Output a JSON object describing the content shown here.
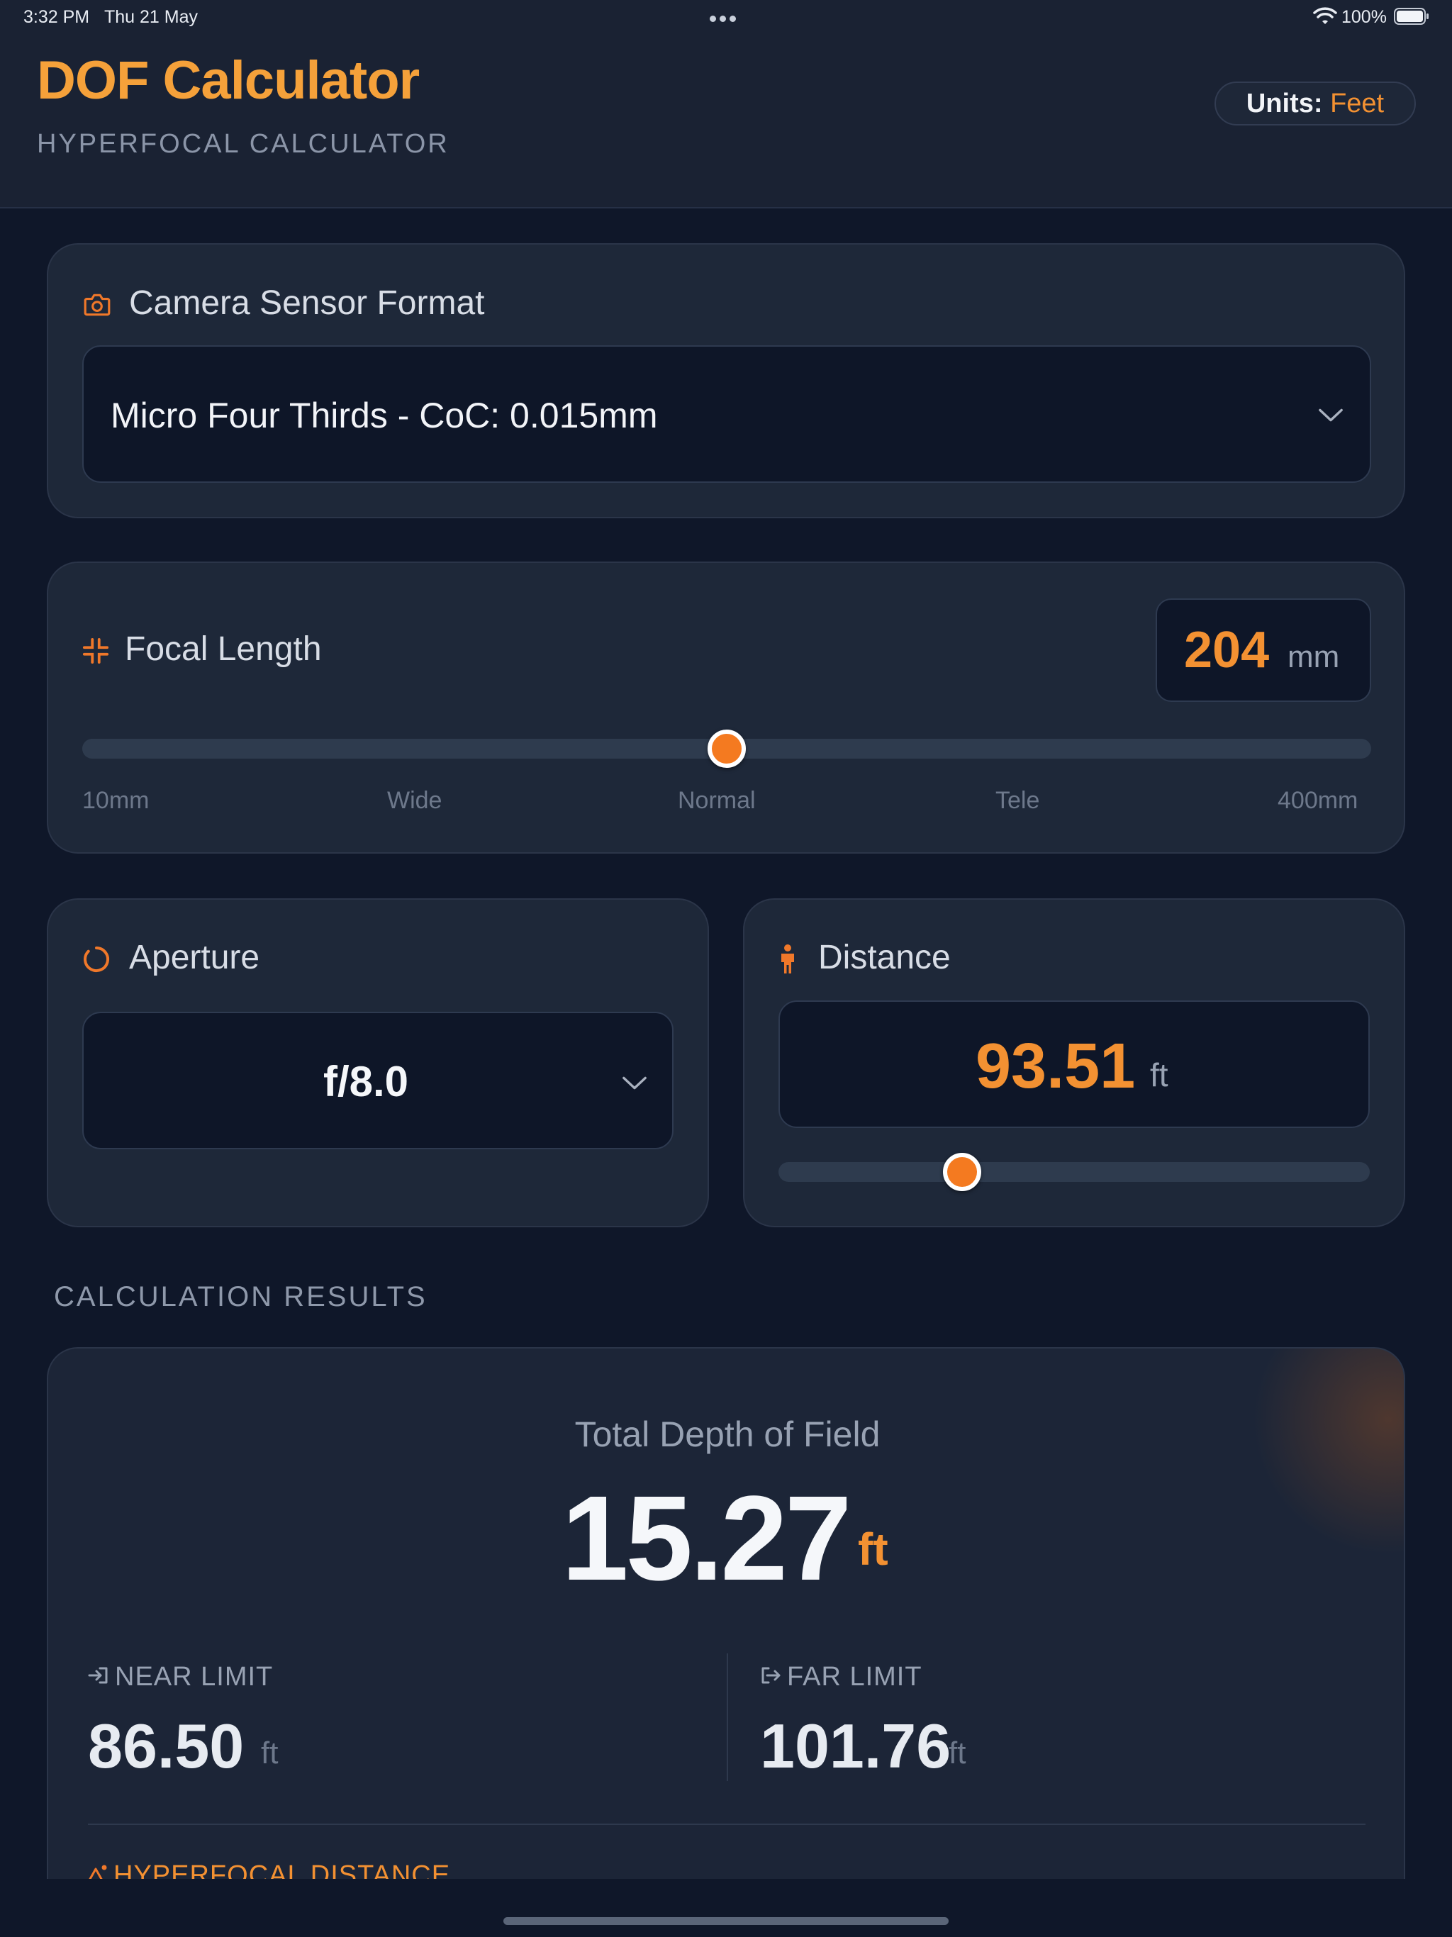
{
  "status_bar": {
    "time": "3:32 PM",
    "date": "Thu 21 May",
    "battery": "100%"
  },
  "header": {
    "title": "DOF Calculator",
    "subtitle": "HYPERFOCAL CALCULATOR",
    "units_label": "Units:",
    "units_value": "Feet"
  },
  "sensor": {
    "title": "Camera Sensor Format",
    "selected": "Micro Four Thirds - CoC: 0.015mm",
    "icon": "camera-icon"
  },
  "focal_length": {
    "title": "Focal Length",
    "value": "204",
    "unit": "mm",
    "slider_fraction": 0.5,
    "ticks": [
      "10mm",
      "Wide",
      "Normal",
      "Tele",
      "400mm"
    ],
    "icon": "focus-frame-icon"
  },
  "aperture": {
    "title": "Aperture",
    "selected": "f/8.0",
    "icon": "aperture-icon"
  },
  "distance": {
    "title": "Distance",
    "value": "93.51",
    "unit": "ft",
    "slider_fraction": 0.31,
    "icon": "person-icon"
  },
  "results": {
    "heading": "CALCULATION RESULTS",
    "total_label": "Total Depth of Field",
    "total_value": "15.27",
    "total_unit": "ft",
    "near_label": "NEAR LIMIT",
    "near_value": "86.50",
    "near_unit": "ft",
    "far_label": "FAR LIMIT",
    "far_value": "101.76",
    "far_unit": "ft",
    "hyperfocal_label": "HYPERFOCAL DISTANCE"
  },
  "colors": {
    "accent": "#f39132",
    "background": "#0f1729",
    "card": "#1e2839"
  }
}
